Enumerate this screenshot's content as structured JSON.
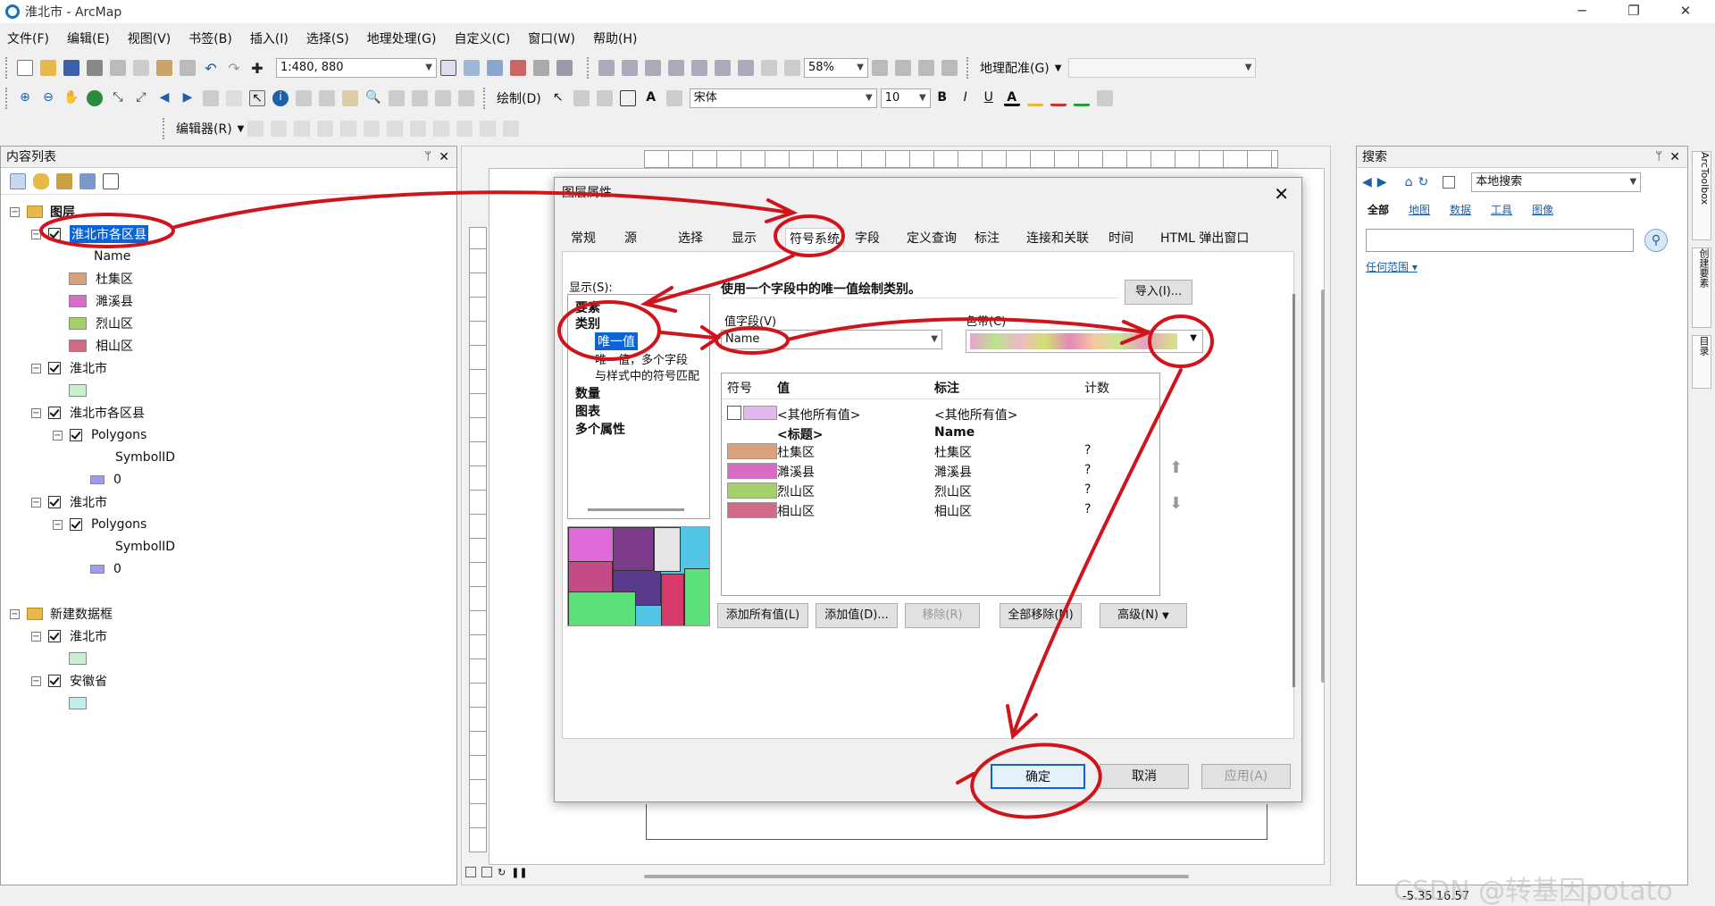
{
  "window": {
    "title": "淮北市 - ArcMap"
  },
  "menu": [
    "文件(F)",
    "编辑(E)",
    "视图(V)",
    "书签(B)",
    "插入(I)",
    "选择(S)",
    "地理处理(G)",
    "自定义(C)",
    "窗口(W)",
    "帮助(H)"
  ],
  "toolbar": {
    "scale_value": "1:480, 880",
    "zoom_value": "58%",
    "georef_label": "地理配准(G)",
    "draw_label": "绘制(D)",
    "font_value": "宋体",
    "fontsize_value": "10",
    "bold": "B",
    "italic": "I",
    "underline": "U",
    "editor_label": "编辑器(R)"
  },
  "toc": {
    "title": "内容列表",
    "items": [
      {
        "label": "图层"
      },
      {
        "label": "淮北市各区县"
      },
      {
        "label": "Name"
      },
      {
        "label": "杜集区",
        "color": "#d9a27e"
      },
      {
        "label": "濉溪县",
        "color": "#d86cc4"
      },
      {
        "label": "烈山区",
        "color": "#a6cf69"
      },
      {
        "label": "相山区",
        "color": "#d16a86"
      },
      {
        "label": "淮北市"
      },
      {
        "label": "淮北市各区县"
      },
      {
        "label": "Polygons"
      },
      {
        "label": "SymbolID"
      },
      {
        "label": "0"
      },
      {
        "label": "淮北市"
      },
      {
        "label": "Polygons"
      },
      {
        "label": "SymbolID"
      },
      {
        "label": "0"
      },
      {
        "label": "新建数据框"
      },
      {
        "label": "淮北市"
      },
      {
        "label": "安徽省"
      }
    ]
  },
  "search_panel": {
    "title": "搜索",
    "scope": "本地搜索",
    "filters": [
      "全部",
      "地图",
      "数据",
      "工具",
      "图像"
    ],
    "extent": "任何范围"
  },
  "side_tabs": [
    "ArcToolbox",
    "创建要素",
    "目录"
  ],
  "dialog": {
    "title": "图层属性",
    "tabs": [
      "常规",
      "源",
      "选择",
      "显示",
      "符号系统",
      "字段",
      "定义查询",
      "标注",
      "连接和关联",
      "时间",
      "HTML 弹出窗口"
    ],
    "show_label": "显示(S):",
    "tree": [
      "要素",
      "类别",
      "唯一值",
      "唯一值，多个字段",
      "与样式中的符号匹配",
      "数量",
      "图表",
      "多个属性"
    ],
    "heading": "使用一个字段中的唯一值绘制类别。",
    "import_label": "导入(I)...",
    "value_field_label": "值字段(V)",
    "value_field_value": "Name",
    "color_ramp_label": "色带(C)",
    "table_headers": [
      "符号",
      "值",
      "标注",
      "计数"
    ],
    "rows": [
      {
        "value": "<其他所有值>",
        "label": "<其他所有值>",
        "count": "",
        "color": "#e2b8ee"
      },
      {
        "value": "<标题>",
        "label": "Name",
        "count": "",
        "color": ""
      },
      {
        "value": "杜集区",
        "label": "杜集区",
        "count": "?",
        "color": "#d9a27e"
      },
      {
        "value": "濉溪县",
        "label": "濉溪县",
        "count": "?",
        "color": "#d86cc4"
      },
      {
        "value": "烈山区",
        "label": "烈山区",
        "count": "?",
        "color": "#a6cf69"
      },
      {
        "value": "相山区",
        "label": "相山区",
        "count": "?",
        "color": "#d16a86"
      }
    ],
    "buttons": [
      "添加所有值(L)",
      "添加值(D)...",
      "移除(R)",
      "全部移除(M)",
      "高级(N)"
    ],
    "ok": "确定",
    "cancel": "取消",
    "apply": "应用(A)"
  },
  "status": {
    "coords": "-5.35  16.57"
  },
  "watermark": "CSDN @转基因potato",
  "colors": {
    "annotation": "#d0141b",
    "selection": "#0a64d6"
  }
}
